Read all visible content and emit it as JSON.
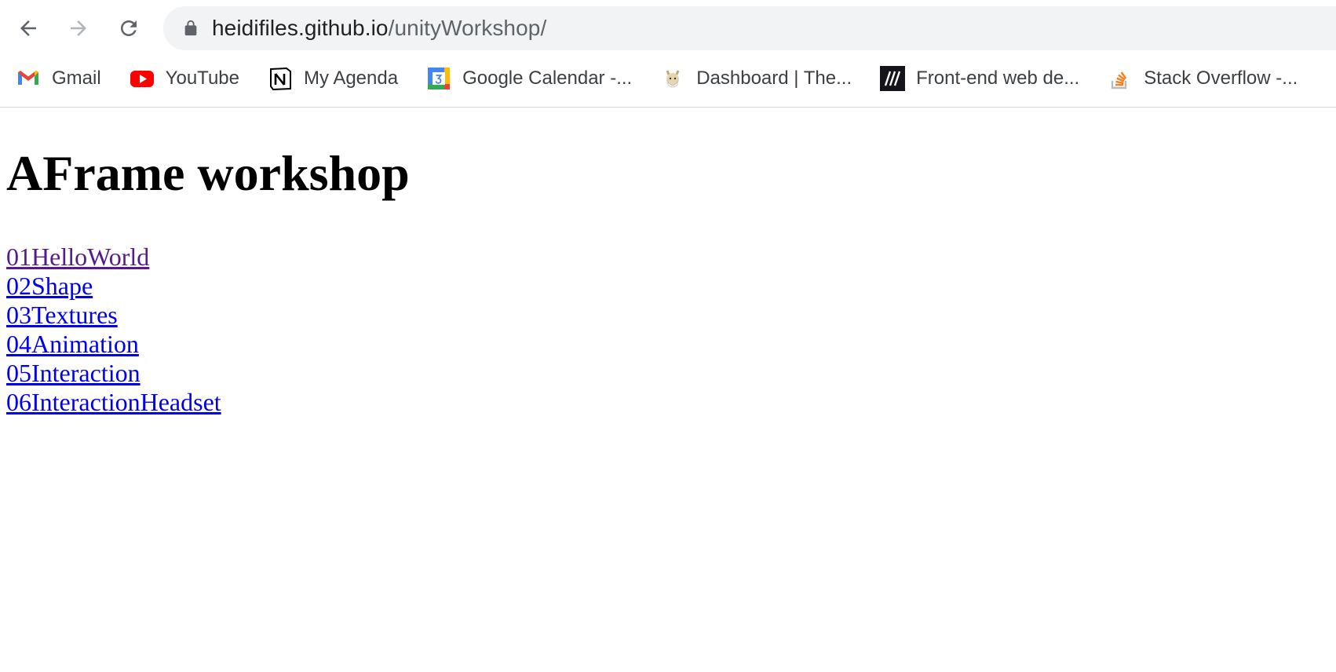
{
  "browser": {
    "url_host": "heidifiles.github.io",
    "url_path": "/unityWorkshop/",
    "bookmarks": [
      {
        "label": "Gmail",
        "icon": "gmail-icon"
      },
      {
        "label": "YouTube",
        "icon": "youtube-icon"
      },
      {
        "label": "My Agenda",
        "icon": "notion-icon"
      },
      {
        "label": "Google Calendar -...",
        "icon": "google-calendar-icon"
      },
      {
        "label": "Dashboard | The...",
        "icon": "dashboard-icon"
      },
      {
        "label": "Front-end web de...",
        "icon": "mdn-icon"
      },
      {
        "label": "Stack Overflow -...",
        "icon": "stackoverflow-icon"
      }
    ]
  },
  "page": {
    "title": "AFrame workshop",
    "links": [
      {
        "label": "01HelloWorld",
        "visited": true
      },
      {
        "label": "02Shape",
        "visited": false
      },
      {
        "label": "03Textures",
        "visited": false
      },
      {
        "label": "04Animation",
        "visited": false
      },
      {
        "label": "05Interaction",
        "visited": false
      },
      {
        "label": "06InteractionHeadset",
        "visited": false
      }
    ]
  },
  "colors": {
    "link": "#0000ee",
    "visited_link": "#551a8b",
    "omnibox_bg": "#f1f3f4"
  }
}
